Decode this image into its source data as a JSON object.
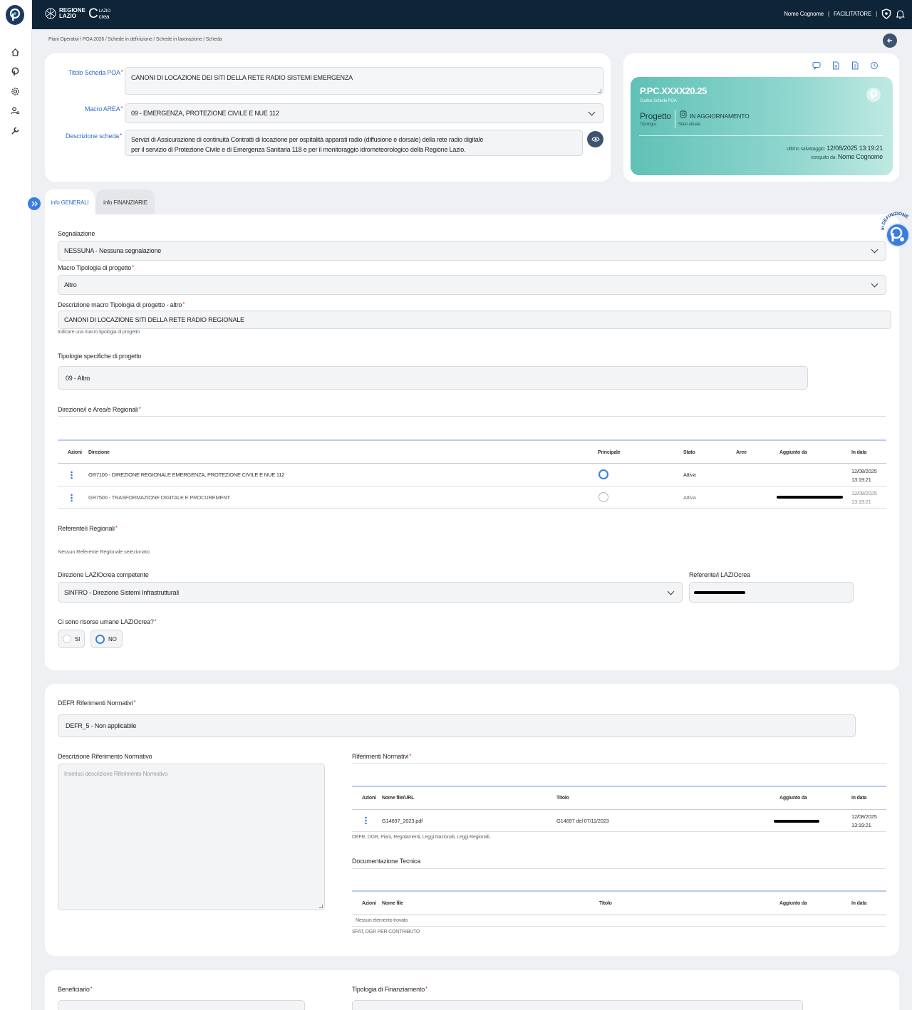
{
  "header": {
    "brand1_line1": "REGIONE",
    "brand1_line2": "LAZIO",
    "brand2_line1": "LAZIO",
    "brand2_line2": "crea",
    "user_name": "Nome Cognome",
    "role": "FACILITATORE",
    "separator": "|"
  },
  "breadcrumb": "Piani Operativi / POA 2026 / Schede in definizione / Schede in lavorazione / Scheda",
  "form_top": {
    "titolo_label": "Titolo Scheda POA",
    "titolo_value": "CANONI DI LOCAZIONE DEI SITI DELLA RETE RADIO SISTEMI EMERGENZA",
    "macro_area_label": "Macro AREA",
    "macro_area_value": "09 - EMERGENZA, PROTEZIONE CIVILE E NUE 112",
    "descrizione_label": "Descrizione scheda",
    "descrizione_line1": "Servizi di Assicurazione di continuità Contratti di locazione per ospitalità apparati radio (diffusione e dorsale) della rete radio digitale",
    "descrizione_line2": "per il servizio di Protezione Civile e di Emergenza Sanitaria 118 e per il monitoraggio idrometeorologico della Regione Lazio.",
    "required_mark": "*"
  },
  "status_card": {
    "code": "P.PC.XXXX20.25",
    "code_caption": "Codice Scheda POA",
    "tipologia": "Progetto",
    "tipologia_caption": "Tipologia",
    "stato": "IN AGGIORNAMENTO",
    "stato_caption": "Stato attuale",
    "saved_label": "ultimo salvataggio:",
    "saved_value": "12/08/2025 13:19:21",
    "by_label": "eseguito da:",
    "by_value": "Nome Cognome",
    "accent": "#7fcfc6"
  },
  "tabs": [
    {
      "label": "info GENERALI",
      "active": true
    },
    {
      "label": "info FINANZIARIE",
      "active": false
    }
  ],
  "badge_text": "in DEFINIZIONE",
  "generali": {
    "segnalazione_label": "Segnalazione",
    "segnalazione_value": "NESSUNA - Nessuna segnalazione",
    "macro_tipologia_label": "Macro Tipologia di progetto",
    "macro_tipologia_value": "Altro",
    "desc_macro_label": "Descrizione macro Tipologia di progetto - altro",
    "desc_macro_value": "CANONI DI LOCAZIONE SITI DELLA RETE RADIO REGIONALE",
    "desc_macro_hint": "Indicare una macro tipologia di progetto",
    "tipologie_label": "Tipologie specifiche di progetto",
    "tipologie_value": "09 - Altro",
    "direzioni_label": "Direzione/i e Area/e Regionali",
    "direzioni_table": {
      "headers": [
        "Azioni",
        "Direzione",
        "Principale",
        "Stato",
        "Aree",
        "Aggiunto da",
        "In data"
      ],
      "rows": [
        {
          "direzione": "GR7100 - DIREZIONE REGIONALE EMERGENZA, PROTEZIONE CIVILE E NUE 112",
          "principale": true,
          "stato": "Attiva",
          "data1": "12/08/2025",
          "data2": "13:19:21"
        },
        {
          "direzione": "GR7500 - TRASFORMAZIONE DIGITALE E PROCUREMENT",
          "principale": false,
          "stato": "Attiva",
          "data1": "12/08/2025",
          "data2": "13:19:21"
        }
      ]
    },
    "referenti_label": "Referente/i Regionali",
    "referenti_empty": "Nessun Referente Regionale selezionato",
    "direzione_laziocrea_label": "Direzione LAZIOcrea competente",
    "direzione_laziocrea_value": "SINFRO - Direzione Sistemi Infrastrutturali",
    "referente_laziocrea_label": "Referente/i LAZIOcrea",
    "risorse_label": "Ci sono risorse umane LAZIOcrea?",
    "si_label": "SI",
    "no_label": "NO",
    "risorse_selected": "NO"
  },
  "normativi": {
    "defr_label": "DEFR Riferimenti Normativi",
    "defr_value": "DEFR_5 - Non applicabile",
    "desc_rif_label": "Descrizione Riferimento Normativo",
    "desc_rif_placeholder": "Inserisci descrizione Riferimento Normativo",
    "rif_label": "Riferimenti Normativi",
    "rif_table": {
      "headers": [
        "Azioni",
        "Nome file/URL",
        "Titolo",
        "Aggiunto da",
        "In data"
      ],
      "rows": [
        {
          "file": "G14697_2023.pdf",
          "titolo": "G14697 del 07/11/2023",
          "data1": "12/08/2025",
          "data2": "13:19:21"
        }
      ]
    },
    "rif_hint": "DEFR, DGR, Piani, Regolamenti, Leggi Nazionali, Leggi Regionali..",
    "doc_label": "Documentazione Tecnica",
    "doc_table": {
      "headers": [
        "Azioni",
        "Nome file",
        "Titolo",
        "Aggiunto da",
        "In data"
      ],
      "empty": "Nessun elemento trovato"
    },
    "doc_hint": "SFAT, DGR PER CONTRIBUTO"
  },
  "bottom": {
    "beneficiario_label": "Beneficiario",
    "tipologia_fin_label": "Tipologia di Finanziamento"
  }
}
